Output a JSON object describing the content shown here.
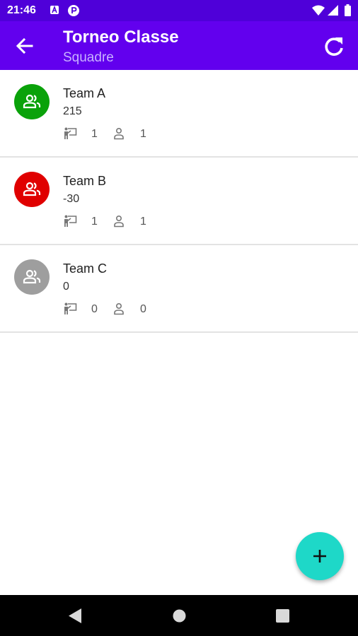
{
  "status_bar": {
    "time": "21:46",
    "left_icons": [
      "notification-a-icon",
      "notification-p-icon"
    ],
    "right_icons": [
      "wifi-icon",
      "signal-icon",
      "battery-icon"
    ]
  },
  "app_bar": {
    "title": "Torneo Classe",
    "subtitle": "Squadre",
    "back_icon": "arrow-back-icon",
    "refresh_icon": "refresh-icon",
    "color": "#6200ee"
  },
  "teams": [
    {
      "name": "Team A",
      "score": "215",
      "teachers": "1",
      "students": "1",
      "avatar_color": "#0aa20a"
    },
    {
      "name": "Team B",
      "score": "-30",
      "teachers": "1",
      "students": "1",
      "avatar_color": "#e00000"
    },
    {
      "name": "Team C",
      "score": "0",
      "teachers": "0",
      "students": "0",
      "avatar_color": "#9e9e9e"
    }
  ],
  "fab": {
    "icon": "plus-icon",
    "color": "#1ed8c8"
  },
  "nav_bar": {
    "icons": [
      "back-triangle-icon",
      "home-circle-icon",
      "recents-square-icon"
    ]
  }
}
